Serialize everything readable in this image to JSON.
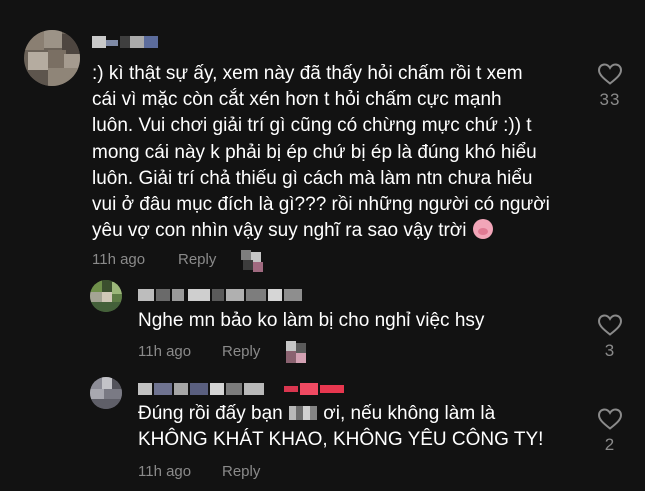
{
  "colors": {
    "background": "#121212",
    "text": "#ffffff",
    "meta": "#8a8a8a"
  },
  "comments": [
    {
      "text": ":) kì thật sự ấy, xem này đã thấy hỏi chấm rồi t xem\ncái vì mặc còn cắt xén hơn t hỏi chấm cực mạnh\nluôn. Vui chơi giải trí gì cũng có chừng mực chứ :)) t\nmong cái này k phải bị ép chứ bị ép là đúng khó hiểu\nluôn. Giải trí chả thiếu gì cách mà làm ntn chưa hiểu\nvui ở đâu mục đích là gì??? rồi những người có người\nyêu vợ con nhìn vậy suy nghĩ ra sao vậy trời",
      "emoji": "pig-face-emoji",
      "time": "11h ago",
      "reply_label": "Reply",
      "likes": "33",
      "like_icon": "heart-outline-icon"
    },
    {
      "text": "Nghe mn bảo ko làm bị cho nghỉ việc hsy",
      "time": "11h ago",
      "reply_label": "Reply",
      "likes": "3",
      "like_icon": "heart-outline-icon"
    },
    {
      "text_before": "Đúng rồi đấy bạn ",
      "text_after": " ơi, nếu không làm là\nKHÔNG KHÁT KHAO, KHÔNG YÊU CÔNG TY!",
      "time": "11h ago",
      "reply_label": "Reply",
      "likes": "2",
      "like_icon": "heart-outline-icon"
    }
  ]
}
